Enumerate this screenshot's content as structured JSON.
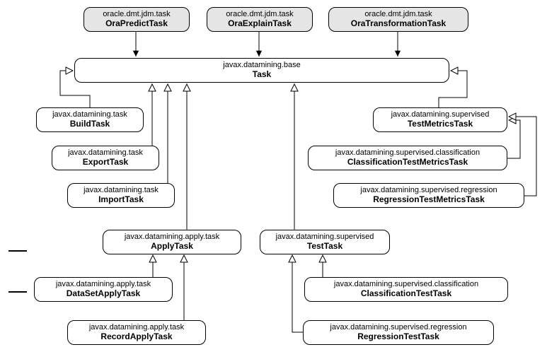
{
  "nodes": {
    "oraPredict": {
      "pkg": "oracle.dmt.jdm.task",
      "cls": "OraPredictTask"
    },
    "oraExplain": {
      "pkg": "oracle.dmt.jdm.task",
      "cls": "OraExplainTask"
    },
    "oraTransform": {
      "pkg": "oracle.dmt.jdm.task",
      "cls": "OraTransformationTask"
    },
    "task": {
      "pkg": "javax.datamining.base",
      "cls": "Task"
    },
    "buildTask": {
      "pkg": "javax.datamining.task",
      "cls": "BuildTask"
    },
    "exportTask": {
      "pkg": "javax.datamining.task",
      "cls": "ExportTask"
    },
    "importTask": {
      "pkg": "javax.datamining.task",
      "cls": "ImportTask"
    },
    "applyTask": {
      "pkg": "javax.datamining.apply.task",
      "cls": "ApplyTask"
    },
    "dataSetApply": {
      "pkg": "javax.datamining.apply.task",
      "cls": "DataSetApplyTask"
    },
    "recordApply": {
      "pkg": "javax.datamining.apply.task",
      "cls": "RecordApplyTask"
    },
    "testTask": {
      "pkg": "javax.datamining.supervised",
      "cls": "TestTask"
    },
    "classTest": {
      "pkg": "javax.datamining.supervised.classification",
      "cls": "ClassificationTestTask"
    },
    "regrTest": {
      "pkg": "javax.datamining.supervised.regression",
      "cls": "RegressionTestTask"
    },
    "testMetrics": {
      "pkg": "javax.datamining.supervised",
      "cls": "TestMetricsTask"
    },
    "classMetrics": {
      "pkg": "javax.datamining.supervised.classification",
      "cls": "ClassificationTestMetricsTask"
    },
    "regrMetrics": {
      "pkg": "javax.datamining.supervised.regression",
      "cls": "RegressionTestMetricsTask"
    }
  }
}
